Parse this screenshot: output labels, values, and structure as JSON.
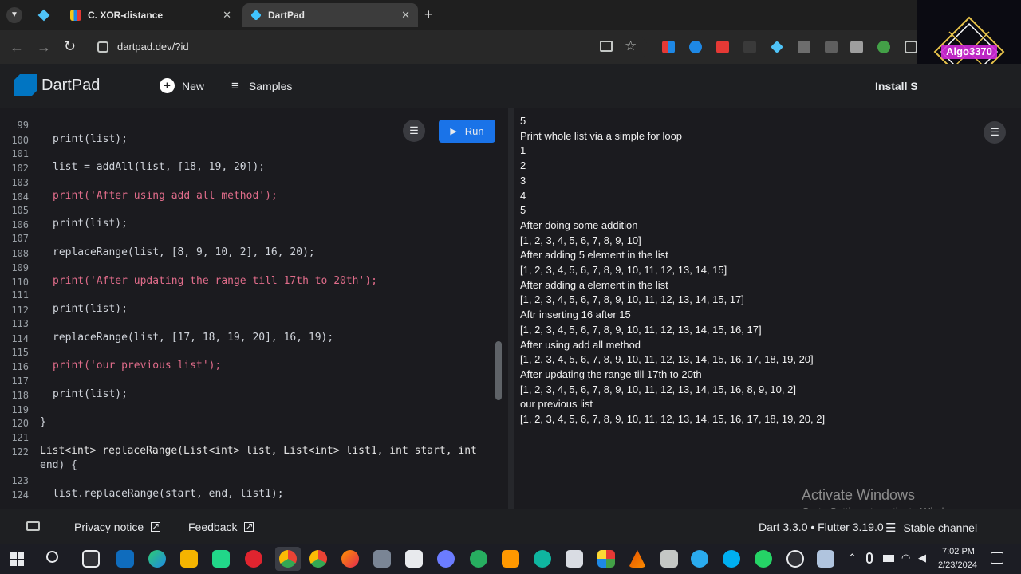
{
  "browser": {
    "tabs": [
      {
        "title": "C. XOR-distance",
        "close": "✕"
      },
      {
        "title": "DartPad",
        "close": "✕"
      }
    ],
    "new_tab": "+",
    "url": "dartpad.dev/?id"
  },
  "app": {
    "name": "DartPad",
    "new_label": "New",
    "samples_label": "Samples",
    "install_label": "Install SD",
    "run_label": "Run"
  },
  "overlay": {
    "channel_badge": "Algo3370"
  },
  "editor": {
    "lines": [
      {
        "n": "99",
        "text": ""
      },
      {
        "n": "100",
        "text": "print(list);"
      },
      {
        "n": "101",
        "text": ""
      },
      {
        "n": "102",
        "text": "list = addAll(list, [18, 19, 20]);"
      },
      {
        "n": "103",
        "text": ""
      },
      {
        "n": "104",
        "text": "print('After using add all method');"
      },
      {
        "n": "105",
        "text": ""
      },
      {
        "n": "106",
        "text": "print(list);"
      },
      {
        "n": "107",
        "text": ""
      },
      {
        "n": "108",
        "text": "replaceRange(list, [8, 9, 10, 2], 16, 20);"
      },
      {
        "n": "109",
        "text": ""
      },
      {
        "n": "110",
        "text": "print('After updating the range till 17th to 20th');"
      },
      {
        "n": "111",
        "text": ""
      },
      {
        "n": "112",
        "text": "print(list);"
      },
      {
        "n": "113",
        "text": ""
      },
      {
        "n": "114",
        "text": "replaceRange(list, [17, 18, 19, 20], 16, 19);"
      },
      {
        "n": "115",
        "text": ""
      },
      {
        "n": "116",
        "text": "print('our previous list');"
      },
      {
        "n": "117",
        "text": ""
      },
      {
        "n": "118",
        "text": "print(list);"
      },
      {
        "n": "119",
        "text": ""
      },
      {
        "n": "120",
        "text": "}"
      },
      {
        "n": "121",
        "text": ""
      },
      {
        "n": "122",
        "text": "List<int> replaceRange(List<int> list, List<int> list1, int start, int"
      },
      {
        "n": "",
        "text": "end) {"
      },
      {
        "n": "123",
        "text": ""
      },
      {
        "n": "124",
        "text": "list.replaceRange(start, end, list1);"
      }
    ]
  },
  "output": {
    "lines": [
      "5",
      "Print whole list via a simple for loop",
      "1",
      "2",
      "3",
      "4",
      "5",
      "After doing some addition",
      "[1, 2, 3, 4, 5, 6, 7, 8, 9, 10]",
      "After adding 5 element in the list",
      "[1, 2, 3, 4, 5, 6, 7, 8, 9, 10, 11, 12, 13, 14, 15]",
      "After adding a element in the list",
      "[1, 2, 3, 4, 5, 6, 7, 8, 9, 10, 11, 12, 13, 14, 15, 17]",
      "Aftr inserting 16 after 15",
      "[1, 2, 3, 4, 5, 6, 7, 8, 9, 10, 11, 12, 13, 14, 15, 16, 17]",
      "After using add all method",
      "[1, 2, 3, 4, 5, 6, 7, 8, 9, 10, 11, 12, 13, 14, 15, 16, 17, 18, 19, 20]",
      "After updating the range till 17th to 20th",
      "[1, 2, 3, 4, 5, 6, 7, 8, 9, 10, 11, 12, 13, 14, 15, 16, 8, 9, 10, 2]",
      "our previous list",
      "[1, 2, 3, 4, 5, 6, 7, 8, 9, 10, 11, 12, 13, 14, 15, 16, 17, 18, 19, 20, 2]"
    ]
  },
  "watermark": {
    "title": "Activate Windows",
    "subtitle": "Go to Settings to activate Windows."
  },
  "footer": {
    "privacy_label": "Privacy notice",
    "feedback_label": "Feedback",
    "version": "Dart 3.3.0 • Flutter 3.19.0",
    "channel": "Stable channel"
  },
  "taskbar": {
    "time": "7:02 PM",
    "date": "2/23/2024"
  },
  "colors": {
    "accent": "#4285f4",
    "run_button": "#1a73e8"
  }
}
